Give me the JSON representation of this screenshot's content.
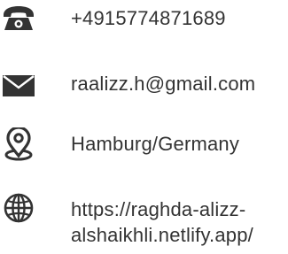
{
  "contact": {
    "phone": {
      "icon": "phone-icon",
      "value": "+4915774871689"
    },
    "email": {
      "icon": "envelope-icon",
      "value": "raalizz.h@gmail.com"
    },
    "location": {
      "icon": "location-pin-icon",
      "value": "Hamburg/Germany"
    },
    "website": {
      "icon": "globe-icon",
      "line1": "https://raghda-alizz-",
      "line2": "alshaikhli.netlify.app/"
    }
  },
  "colors": {
    "icon": "#333333",
    "text": "#333333",
    "background": "#ffffff"
  }
}
